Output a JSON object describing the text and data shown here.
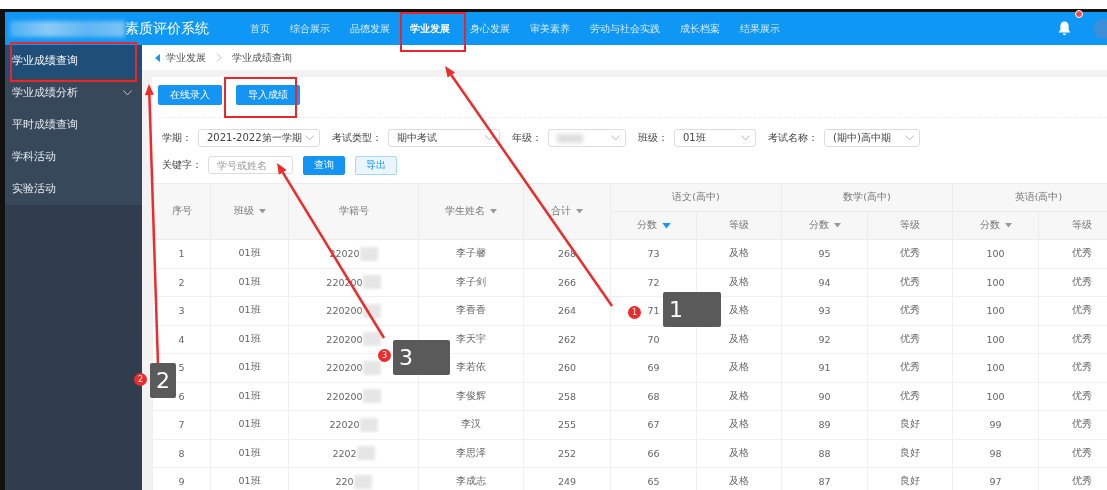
{
  "header": {
    "title": "素质评价系统",
    "nav": [
      {
        "label": "首页",
        "selected": false
      },
      {
        "label": "综合展示",
        "selected": false
      },
      {
        "label": "品德发展",
        "selected": false
      },
      {
        "label": "学业发展",
        "selected": true
      },
      {
        "label": "身心发展",
        "selected": false
      },
      {
        "label": "审美素养",
        "selected": false
      },
      {
        "label": "劳动与社会实践",
        "selected": false
      },
      {
        "label": "成长档案",
        "selected": false
      },
      {
        "label": "结果展示",
        "selected": false
      }
    ],
    "notification_dot": true
  },
  "sidebar": {
    "items": [
      {
        "label": "学业成绩查询",
        "selected": true,
        "expandable": false
      },
      {
        "label": "学业成绩分析",
        "selected": false,
        "expandable": true
      },
      {
        "label": "平时成绩查询",
        "selected": false,
        "expandable": false
      },
      {
        "label": "学科活动",
        "selected": false,
        "expandable": false
      },
      {
        "label": "实验活动",
        "selected": false,
        "expandable": false
      }
    ]
  },
  "breadcrumb": [
    "学业发展",
    "学业成绩查询"
  ],
  "actions": [
    "在线录入",
    "导入成绩"
  ],
  "filters": [
    {
      "label": "学期：",
      "value": "2021-2022第一学期"
    },
    {
      "label": "考试类型：",
      "value": "期中考试"
    },
    {
      "label": "年级："
    },
    {
      "label": "班级：",
      "value": "01班"
    },
    {
      "label": "考试名称：",
      "value": "(期中)高中期"
    }
  ],
  "keyword": {
    "label": "关键字：",
    "placeholder": "学号或姓名",
    "buttons": [
      {
        "label": "查询",
        "kind": "primary"
      },
      {
        "label": "导出",
        "kind": "plain"
      }
    ]
  },
  "table": {
    "column_groups": [
      {
        "label": "语文(高中)"
      },
      {
        "label": "数学(高中)"
      },
      {
        "label": "英语(高中)"
      }
    ],
    "columns": [
      {
        "label": "序号",
        "sortable": false,
        "sorted": false,
        "grouped": false
      },
      {
        "label": "班级",
        "sortable": true,
        "sorted": false,
        "grouped": false
      },
      {
        "label": "学籍号",
        "sortable": false,
        "sorted": false,
        "grouped": false
      },
      {
        "label": "学生姓名",
        "sortable": true,
        "sorted": false,
        "grouped": false
      },
      {
        "label": "合计",
        "sortable": true,
        "sorted": false,
        "grouped": false
      },
      {
        "label": "分数",
        "sortable": true,
        "sorted": true,
        "grouped": true
      },
      {
        "label": "等级",
        "sortable": false,
        "sorted": false,
        "grouped": true
      },
      {
        "label": "分数",
        "sortable": true,
        "sorted": false,
        "grouped": true
      },
      {
        "label": "等级",
        "sortable": false,
        "sorted": false,
        "grouped": true
      },
      {
        "label": "分数",
        "sortable": true,
        "sorted": false,
        "grouped": true
      },
      {
        "label": "等级",
        "sortable": false,
        "sorted": false,
        "grouped": true
      }
    ],
    "rows": [
      [
        "1",
        "01班",
        "22020",
        "李子馨",
        "268",
        "73",
        "及格",
        "95",
        "优秀",
        "100",
        "优秀"
      ],
      [
        "2",
        "01班",
        "220200",
        "李子剑",
        "266",
        "72",
        "及格",
        "94",
        "优秀",
        "100",
        "优秀"
      ],
      [
        "3",
        "01班",
        "220200",
        "李香香",
        "264",
        "71",
        "及格",
        "93",
        "优秀",
        "100",
        "优秀"
      ],
      [
        "4",
        "01班",
        "220200",
        "李天宇",
        "262",
        "70",
        "及格",
        "92",
        "优秀",
        "100",
        "优秀"
      ],
      [
        "5",
        "01班",
        "220200",
        "李若依",
        "260",
        "69",
        "及格",
        "91",
        "优秀",
        "100",
        "优秀"
      ],
      [
        "6",
        "01班",
        "220200",
        "李俊辉",
        "258",
        "68",
        "及格",
        "90",
        "优秀",
        "100",
        "优秀"
      ],
      [
        "7",
        "01班",
        "22020",
        "李汉",
        "255",
        "67",
        "及格",
        "89",
        "良好",
        "99",
        "优秀"
      ],
      [
        "8",
        "01班",
        "2202",
        "李思泽",
        "252",
        "66",
        "及格",
        "88",
        "良好",
        "98",
        "优秀"
      ],
      [
        "9",
        "01班",
        "220",
        "李成志",
        "249",
        "65",
        "及格",
        "87",
        "良好",
        "97",
        "优秀"
      ]
    ]
  },
  "annotations": [
    {
      "badge": "1",
      "label": "1"
    },
    {
      "badge": "2",
      "label": "2"
    },
    {
      "badge": "3",
      "label": "3"
    }
  ]
}
